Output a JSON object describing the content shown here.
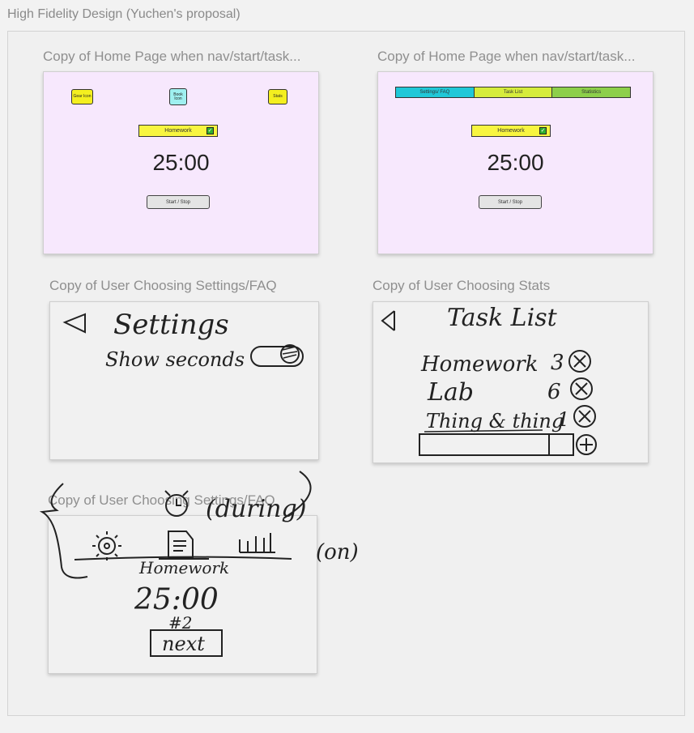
{
  "section": {
    "title": "High Fidelity Design (Yuchen's proposal)"
  },
  "frames": {
    "home_icons": {
      "label": "Copy of Home Page when nav/start/task...",
      "gear_label": "Gear Icon",
      "book_label": "Book Icon",
      "stats_label": "Stats",
      "task_label": "Homework",
      "timer": "25:00",
      "start_stop": "Start / Stop"
    },
    "home_tabs": {
      "label": "Copy of Home Page when nav/start/task...",
      "tabs": [
        "Settings/ FAQ",
        "Task List",
        "Statistics"
      ],
      "tab_colors": [
        "#20c8d8",
        "#d6ec3c",
        "#8dcf4a"
      ],
      "task_label": "Homework",
      "timer": "25:00",
      "start_stop": "Start / Stop"
    },
    "settings": {
      "label": "Copy of User Choosing Settings/FAQ",
      "hand_title": "Settings",
      "hand_option": "Show seconds"
    },
    "stats": {
      "label": "Copy of User Choosing Stats",
      "hand_title": "Task List",
      "tasks": [
        {
          "name": "Homework",
          "count": "3"
        },
        {
          "name": "Lab",
          "count": "6"
        },
        {
          "name": "Thing & thing",
          "count": "1"
        }
      ]
    },
    "sketch": {
      "label": "Copy of User Choosing Settings/FAQ",
      "annotation_during": "(during)",
      "annotation_on": "(on)",
      "hand_task": "Homework",
      "hand_timer": "25:00",
      "hand_round": "#2",
      "hand_next": "next"
    }
  },
  "colors": {
    "pink_bg": "#f7e8fd",
    "yellow": "#f4ef1f",
    "cyan": "#9ff0f0"
  }
}
